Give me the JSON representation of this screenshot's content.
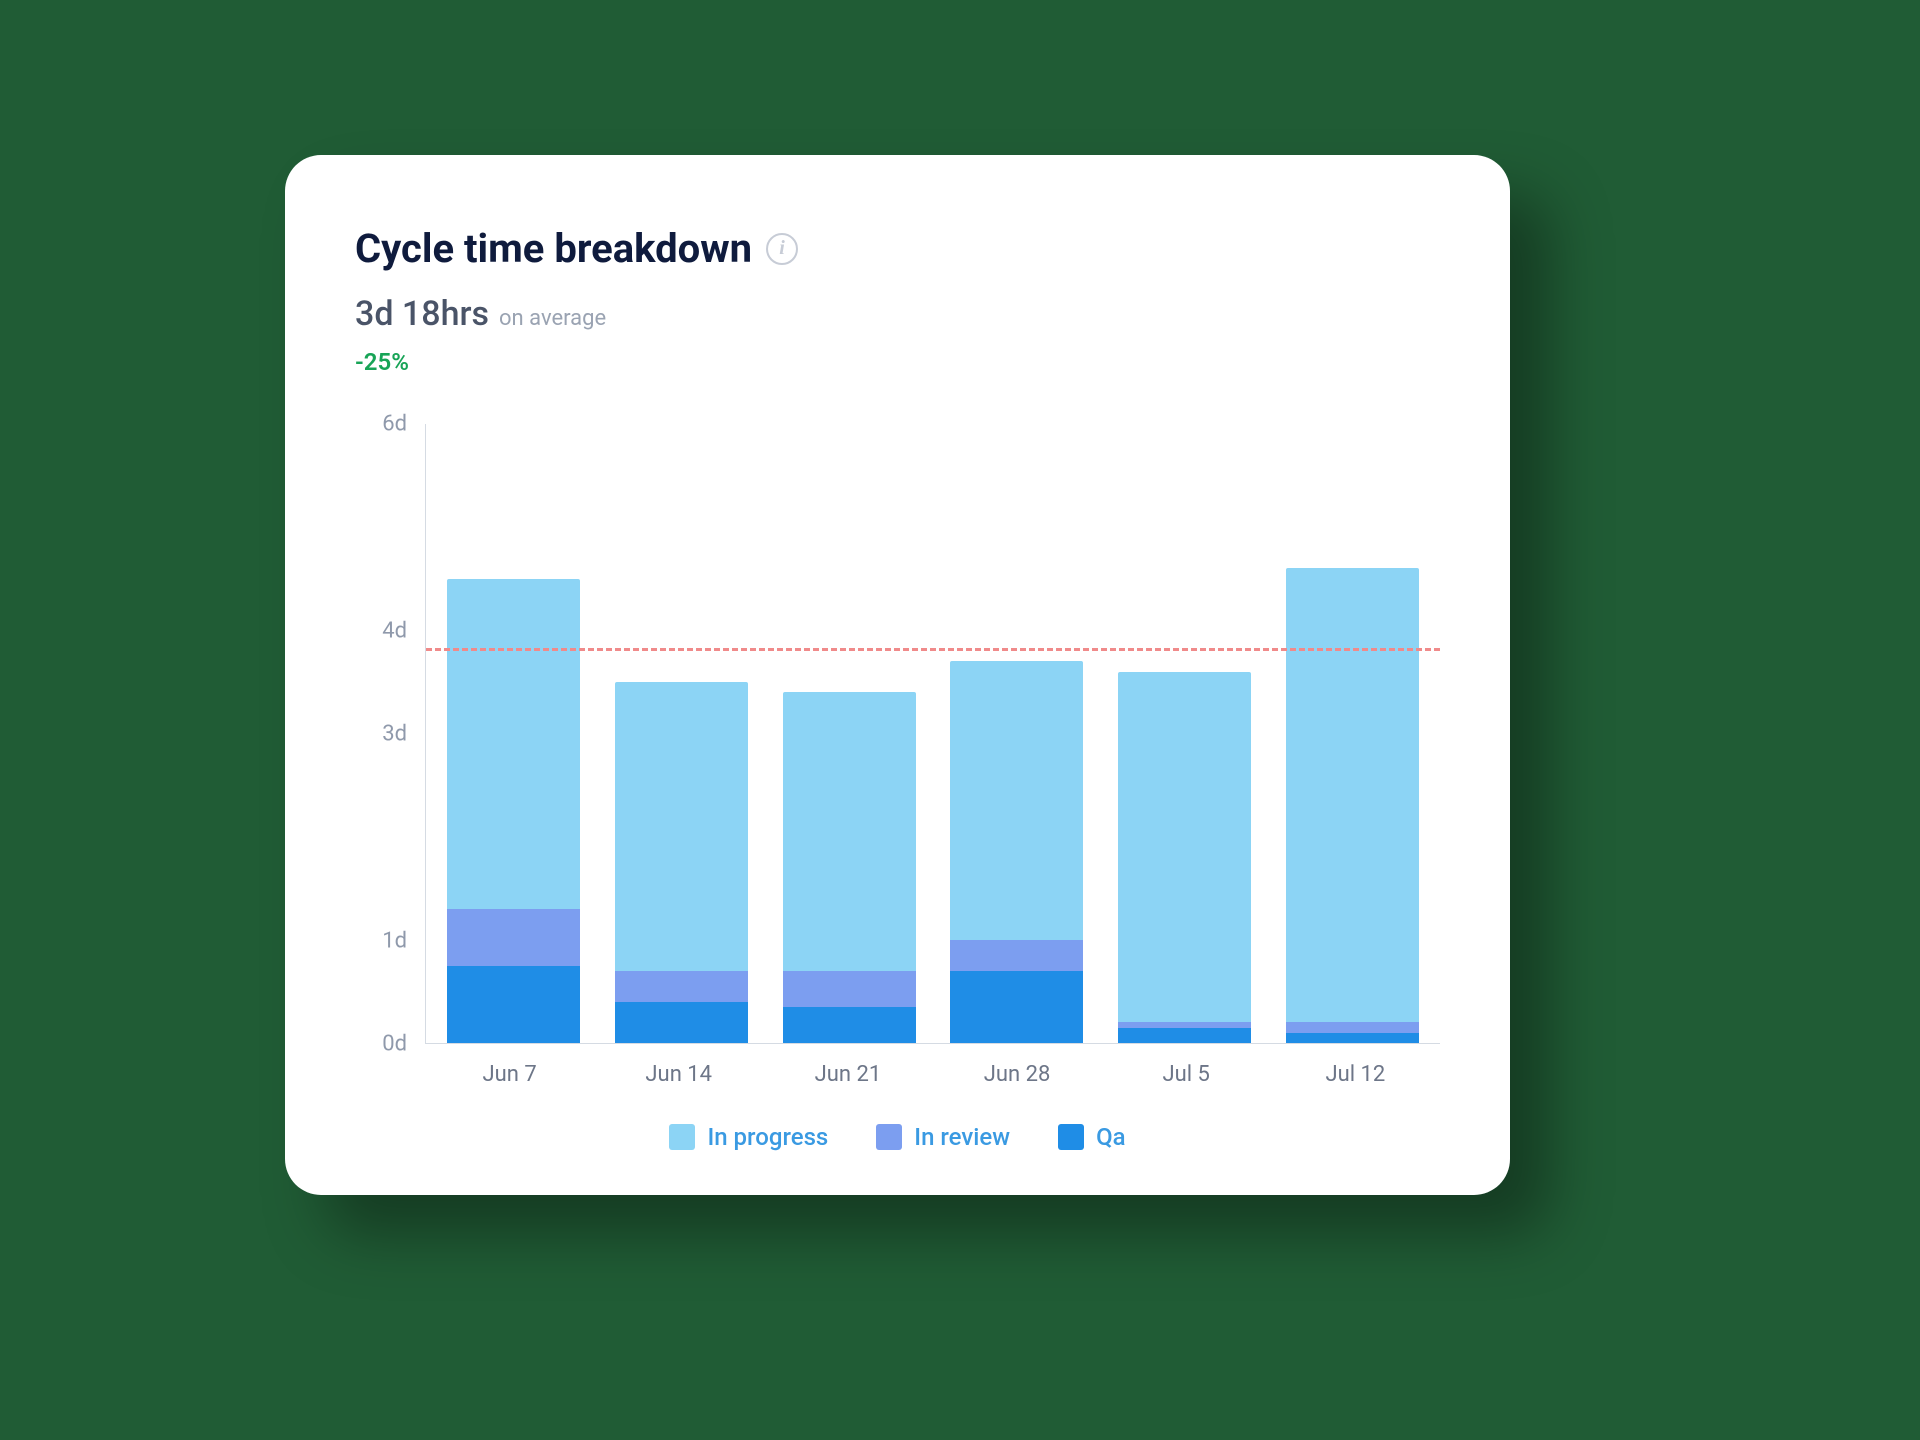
{
  "header": {
    "title": "Cycle time breakdown",
    "info_glyph": "i",
    "avg_value": "3d 18hrs",
    "avg_suffix": "on average",
    "delta": "-25%"
  },
  "chart_data": {
    "type": "bar",
    "stacked": true,
    "title": "Cycle time breakdown",
    "xlabel": "",
    "ylabel": "",
    "ylim": [
      0,
      6
    ],
    "y_ticks": [
      "0d",
      "1d",
      "3d",
      "4d",
      "6d"
    ],
    "y_tick_values": [
      0,
      1,
      3,
      4,
      6
    ],
    "categories": [
      "Jun 7",
      "Jun 14",
      "Jun 21",
      "Jun 28",
      "Jul 5",
      "Jul 12"
    ],
    "series": [
      {
        "name": "In progress",
        "color": "#8cd4f5",
        "values": [
          3.2,
          2.8,
          2.7,
          2.7,
          3.4,
          4.4
        ]
      },
      {
        "name": "In review",
        "color": "#7c9ef0",
        "values": [
          0.55,
          0.3,
          0.35,
          0.3,
          0.05,
          0.1
        ]
      },
      {
        "name": "Qa",
        "color": "#1f8de6",
        "values": [
          0.75,
          0.4,
          0.35,
          0.7,
          0.15,
          0.1
        ]
      }
    ],
    "reference_line": {
      "value": 3.8,
      "label": "average",
      "color": "#f08a8a"
    },
    "legend_position": "bottom"
  },
  "legend": {
    "items": [
      {
        "label": "In progress",
        "color": "#8cd4f5"
      },
      {
        "label": "In review",
        "color": "#7c9ef0"
      },
      {
        "label": "Qa",
        "color": "#1f8de6"
      }
    ]
  }
}
